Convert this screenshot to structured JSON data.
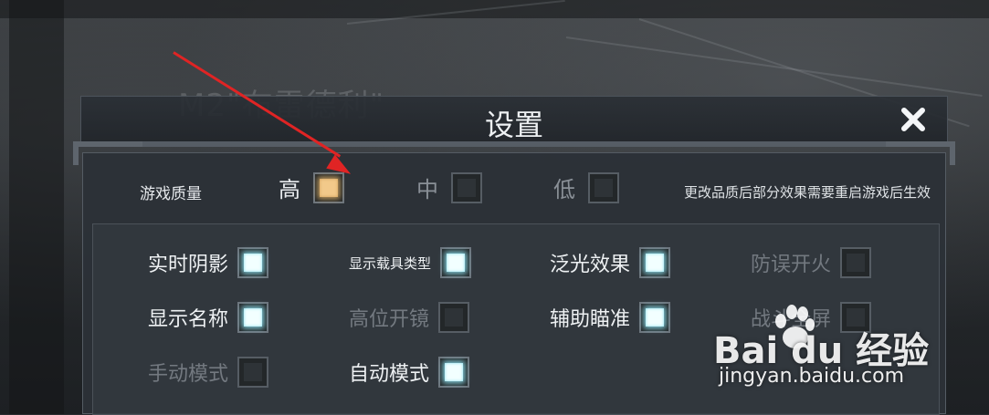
{
  "background": {
    "faded_text": "M2\"布雷德利\""
  },
  "dialog": {
    "title": "设置",
    "close_icon": "close-icon",
    "quality": {
      "label": "游戏质量",
      "options": [
        {
          "label": "高",
          "selected": true
        },
        {
          "label": "中",
          "selected": false
        },
        {
          "label": "低",
          "selected": false
        }
      ],
      "note": "更改品质后部分效果需要重启游戏后生效"
    },
    "options": [
      {
        "label": "实时阴影",
        "checked": true,
        "enabled": true
      },
      {
        "label": "显示载具类型",
        "checked": true,
        "enabled": true
      },
      {
        "label": "泛光效果",
        "checked": true,
        "enabled": true
      },
      {
        "label": "防误开火",
        "checked": false,
        "enabled": false
      },
      {
        "label": "显示名称",
        "checked": true,
        "enabled": true
      },
      {
        "label": "高位开镜",
        "checked": false,
        "enabled": false
      },
      {
        "label": "辅助瞄准",
        "checked": true,
        "enabled": true
      },
      {
        "label": "战斗全屏",
        "checked": false,
        "enabled": false
      },
      {
        "label": "手动模式",
        "checked": false,
        "enabled": false
      },
      {
        "label": "自动模式",
        "checked": true,
        "enabled": true
      }
    ]
  },
  "watermark": {
    "brand": "Bai du 经验",
    "url": "jingyan.baidu.com"
  },
  "colors": {
    "arrow": "#e02424",
    "checked_glow": "#f2ffff",
    "selected_quality": "#f2c98a"
  }
}
